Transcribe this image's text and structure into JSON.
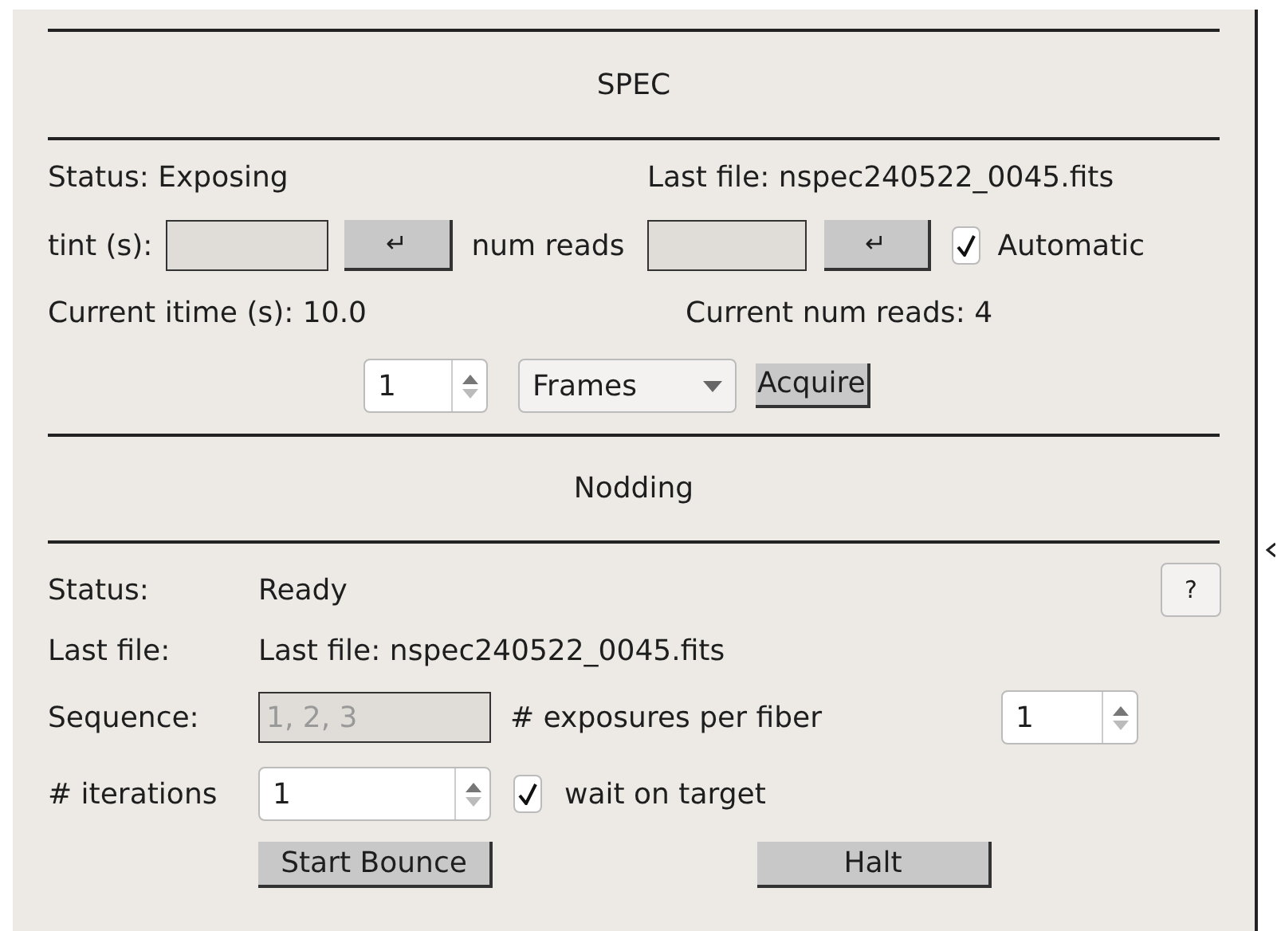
{
  "spec": {
    "title": "SPEC",
    "status": "Status: Exposing",
    "last_file": "Last file: nspec240522_0045.fits",
    "tint_label": "tint (s):",
    "tint_enter": "↵",
    "num_reads_label": "num reads",
    "num_reads_enter": "↵",
    "automatic": {
      "label": "Automatic",
      "checked": true
    },
    "current_itime": "Current itime (s): 10.0",
    "current_num_reads": "Current num reads: 4",
    "count": "1",
    "unit": "Frames",
    "acquire": "Acquire"
  },
  "nodding": {
    "title": "Nodding",
    "status_label": "Status:",
    "status": "Ready",
    "help": "?",
    "last_file_label": "Last file:",
    "last_file": "Last file: nspec240522_0045.fits",
    "sequence_label": "Sequence:",
    "sequence": {
      "value": "1, 2, 3",
      "disabled": true
    },
    "exposures_label": "# exposures per fiber",
    "exposures": "1",
    "iterations_label": "# iterations",
    "iterations": "1",
    "wait_on_target": {
      "label": "wait on target",
      "checked": true
    },
    "start_bounce": "Start Bounce",
    "halt": "Halt"
  }
}
